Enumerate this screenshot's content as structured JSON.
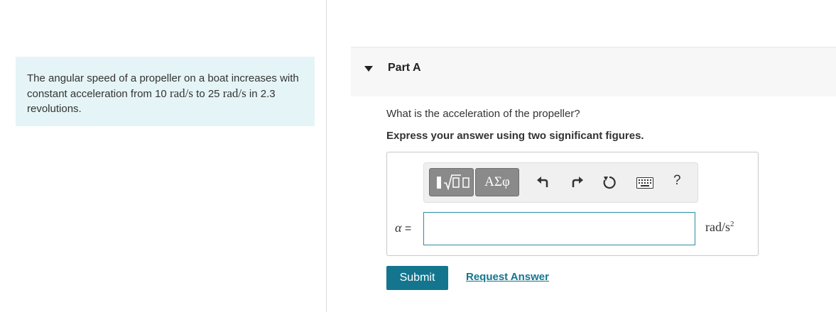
{
  "problem": {
    "text_1": "The angular speed of a propeller on a boat increases with constant acceleration from 10 ",
    "unit_1": "rad/s",
    "text_2": " to 25 ",
    "unit_2": "rad/s",
    "text_3": " in 2.3 revolutions."
  },
  "part": {
    "title": "Part A",
    "question": "What is the acceleration of the propeller?",
    "instruction": "Express your answer using two significant figures."
  },
  "toolbar": {
    "greek_label": "ΑΣφ",
    "help_label": "?",
    "icons": [
      "templates-icon",
      "greek-symbols",
      "undo-icon",
      "redo-icon",
      "reset-icon",
      "keyboard-icon",
      "help-icon"
    ]
  },
  "answer": {
    "label_symbol": "α",
    "label_equals": " =",
    "value": "",
    "unit_base": "rad/s",
    "unit_exp": "2"
  },
  "actions": {
    "submit_label": "Submit",
    "request_label": "Request Answer"
  },
  "colors": {
    "accent": "#14758e",
    "problem_bg": "#e5f4f6",
    "input_border": "#2a8fa5"
  }
}
